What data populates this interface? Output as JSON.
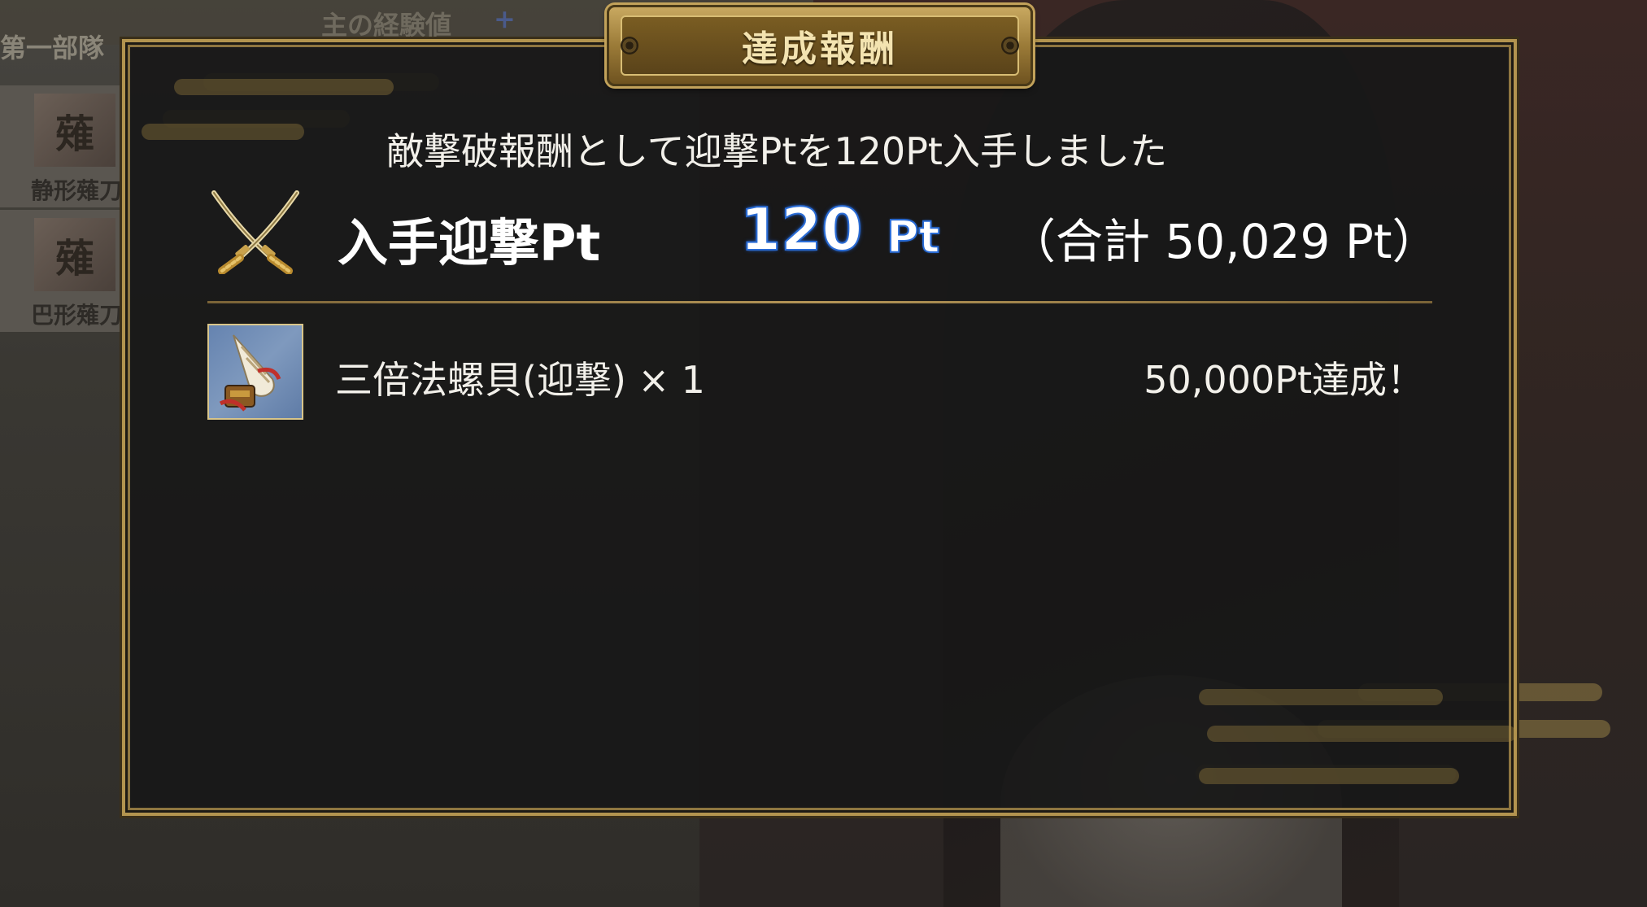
{
  "background": {
    "troop_label": "第一部隊",
    "exp_label": "主の経験値",
    "plus_icon": "plus-icon",
    "cards": [
      {
        "crest": "薙",
        "name": "静形薙刀"
      },
      {
        "crest": "薙",
        "name": "巴形薙刀"
      }
    ]
  },
  "dialog": {
    "title": "達成報酬",
    "message": "敵撃破報酬として迎撃Ptを120Pt入手しました",
    "points": {
      "icon": "crossed-swords-icon",
      "label": "入手迎撃Pt",
      "value": "120",
      "unit": "Pt",
      "total": "（合計 50,029 Pt）"
    },
    "rewards": [
      {
        "icon": "conch-shell-icon",
        "name": "三倍法螺貝(迎撃) × 1",
        "note": "50,000Pt達成！"
      }
    ]
  },
  "colors": {
    "frame_gold": "#b3944f",
    "points_blue": "#2a6cd6",
    "panel_bg": "#181818"
  }
}
